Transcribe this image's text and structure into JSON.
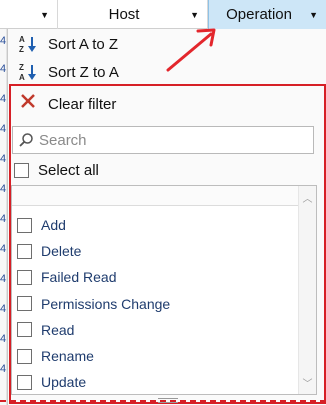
{
  "header": {
    "host_label": "Host",
    "operation_label": "Operation",
    "dropdown_glyph": "▼"
  },
  "left_strip_digits": [
    "4",
    "4",
    "4",
    "4",
    "4",
    "4",
    "4",
    "4",
    "4",
    "4",
    "4",
    "4"
  ],
  "menu": {
    "sort_az_label": "Sort A to Z",
    "sort_za_label": "Sort Z to A",
    "clear_filter_label": "Clear filter"
  },
  "filter": {
    "search_placeholder": "Search",
    "select_all_label": "Select all",
    "items": [
      {
        "label": "Add",
        "checked": false
      },
      {
        "label": "Delete",
        "checked": false
      },
      {
        "label": "Failed Read",
        "checked": false
      },
      {
        "label": "Permissions Change",
        "checked": false
      },
      {
        "label": "Read",
        "checked": false
      },
      {
        "label": "Rename",
        "checked": false
      },
      {
        "label": "Update",
        "checked": false
      }
    ]
  },
  "colors": {
    "highlight_red": "#d61f26",
    "selected_header_bg": "#cde6f7",
    "item_text": "#1f3c6e"
  },
  "icons": {
    "sort_az": "sort-az-icon",
    "sort_za": "sort-za-icon",
    "clear": "clear-filter-icon",
    "search": "search-icon",
    "callout": "red-arrow-icon"
  }
}
